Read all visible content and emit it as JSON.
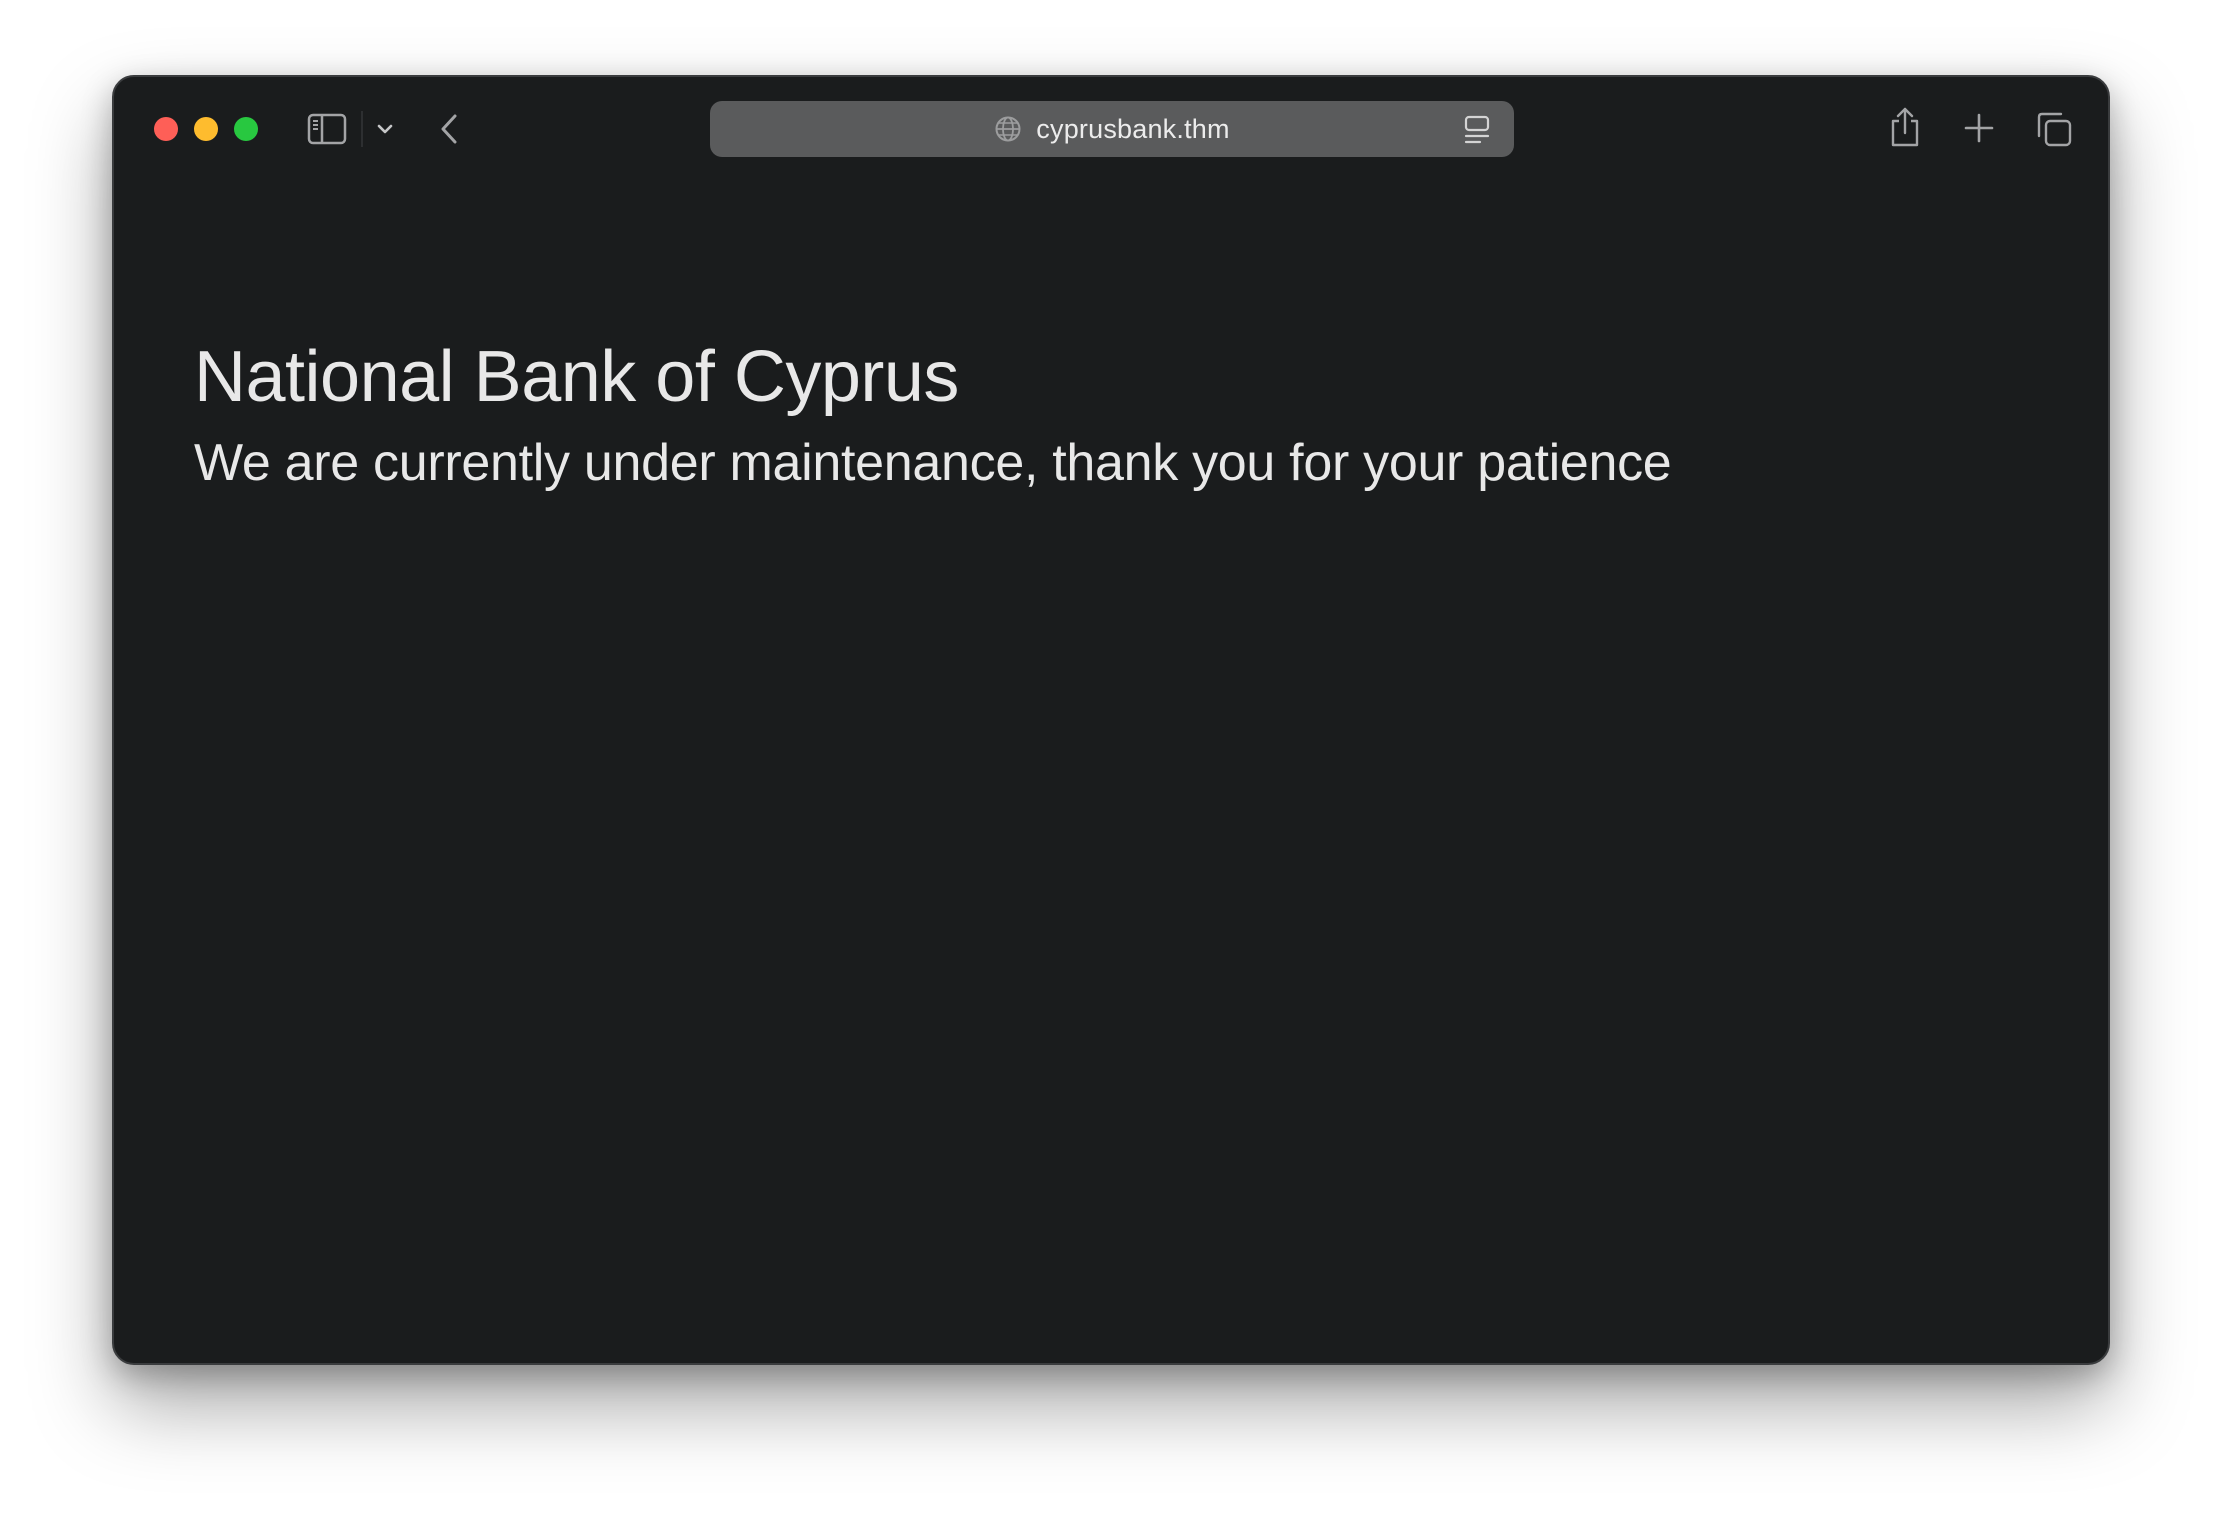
{
  "browser": {
    "url": "cyprusbank.thm",
    "icons": {
      "sidebar": "sidebar-icon",
      "chevron": "chevron-down-icon",
      "back": "back-arrow-icon",
      "globe": "globe-icon",
      "reader": "reader-mode-icon",
      "share": "share-icon",
      "new_tab": "plus-icon",
      "tabs": "tab-overview-icon"
    },
    "colors": {
      "close": "#fe5f57",
      "minimize": "#febc2e",
      "maximize": "#28c840",
      "window_bg": "#1a1c1d",
      "address_bar": "#5a5b5c"
    }
  },
  "page": {
    "title": "National Bank of Cyprus",
    "message": "We are currently under maintenance, thank you for your patience",
    "colors": {
      "background": "#1a1c1d",
      "text": "#e8e8e8"
    }
  }
}
